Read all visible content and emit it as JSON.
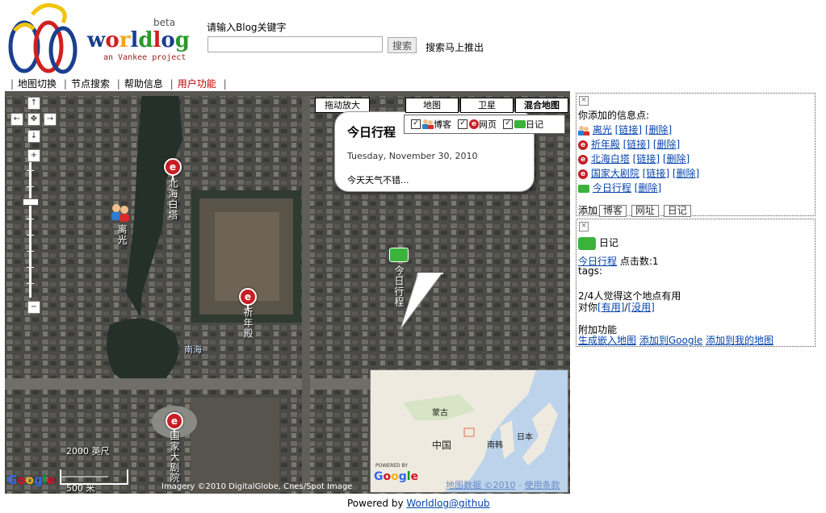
{
  "logo": {
    "name": "worldlog",
    "beta": "beta",
    "tagline": "an Vankee project"
  },
  "search": {
    "label": "请输入Blog关键字",
    "value": "",
    "placeholder": "",
    "button": "搜索",
    "hint": "搜索马上推出"
  },
  "nav": {
    "items": [
      {
        "label": "地图切换",
        "active": false
      },
      {
        "label": "节点搜索",
        "active": false
      },
      {
        "label": "帮助信息",
        "active": false
      },
      {
        "label": "用户功能",
        "active": true
      }
    ]
  },
  "map": {
    "drag_zoom": "拖动放大",
    "types": [
      {
        "label": "地图",
        "selected": false
      },
      {
        "label": "卫星",
        "selected": false
      },
      {
        "label": "混合地图",
        "selected": true
      }
    ],
    "layers": [
      {
        "label": "博客",
        "checked": true
      },
      {
        "label": "网页",
        "checked": true
      },
      {
        "label": "日记",
        "checked": true
      }
    ],
    "markers": [
      "北海白塔",
      "离光",
      "祈年殿",
      "今日行程",
      "国家大剧院"
    ],
    "area_label": "南海",
    "scale_top": "2000 英尺",
    "scale_bottom": "500 米",
    "imagery": "Imagery ©2010 DigitalGlobe, Cnes/Spot Image",
    "google": "Google",
    "bubble": {
      "title": "今日行程",
      "date": "Tuesday, November 30, 2010",
      "body": "今天天气不错..."
    },
    "overview": {
      "labels": [
        "蒙古",
        "中国",
        "南韩",
        "日本"
      ],
      "powered": "POWERED BY",
      "google": "Google",
      "data_link": "地图数据 ©2010",
      "sep": " - ",
      "terms_link": "使用条款"
    }
  },
  "panel1": {
    "heading": "你添加的信息点:",
    "link_label": "[链接]",
    "delete_label": "[删除]",
    "items": [
      {
        "name": "离光",
        "icon": "people-icon",
        "has_link": true
      },
      {
        "name": "祈年殿",
        "icon": "e-icon",
        "has_link": true
      },
      {
        "name": "北海白塔",
        "icon": "e-icon",
        "has_link": true
      },
      {
        "name": "国家大剧院",
        "icon": "e-icon",
        "has_link": true
      },
      {
        "name": "今日行程",
        "icon": "folder-icon",
        "has_link": false
      }
    ],
    "add_label": "添加",
    "add_buttons": [
      "博客",
      "网址",
      "日记"
    ]
  },
  "panel2": {
    "type": "日记",
    "title_link": "今日行程",
    "clicks": "点击数:1",
    "tags": "tags:",
    "useful_text": "2/4人觉得这个地点有用",
    "vote_prefix": "对你",
    "vote_yes": "[有用]",
    "vote_sep": "/",
    "vote_no": "[没用]",
    "extra_heading": "附加功能",
    "extra_links": [
      "生成嵌入地图",
      "添加到Google",
      "添加到我的地图"
    ]
  },
  "footer": {
    "prefix": "Powered by ",
    "link": "Worldlog@github"
  }
}
